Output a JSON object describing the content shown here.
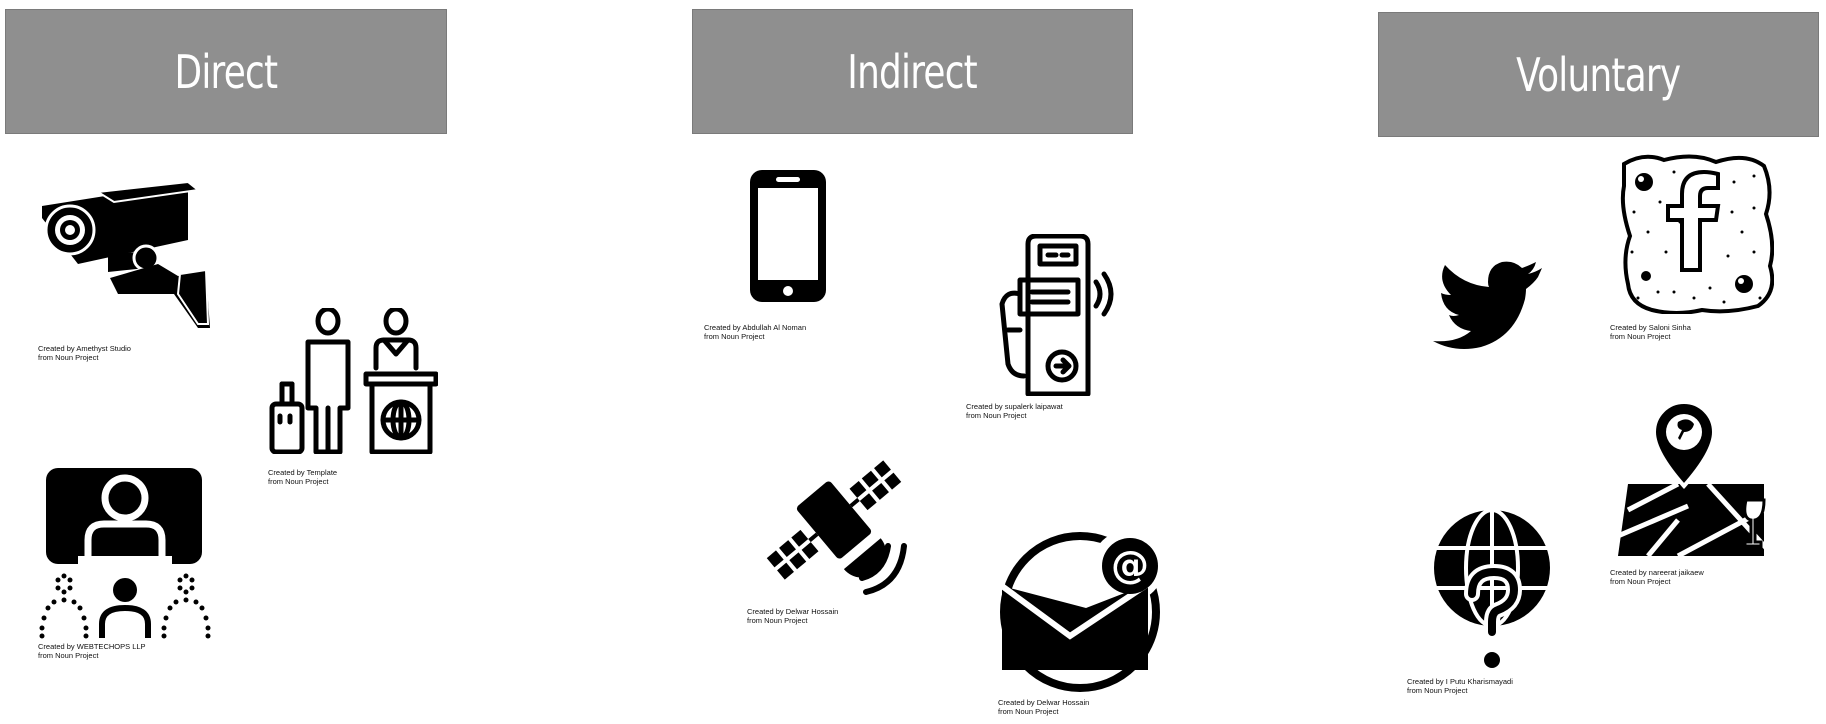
{
  "headers": {
    "direct": "Direct",
    "indirect": "Indirect",
    "voluntary": "Voluntary"
  },
  "colors": {
    "header_bg": "#8f8f8f",
    "header_text": "#ffffff",
    "icon": "#000000"
  },
  "direct": [
    {
      "icon": "cctv-camera-icon",
      "credit": "Created by Amethyst Studio",
      "source": "from Noun Project"
    },
    {
      "icon": "airport-checkin-icon",
      "credit": "Created by Template",
      "source": "from Noun Project"
    },
    {
      "icon": "presentation-audience-icon",
      "credit": "Created by WEBTECHOPS LLP",
      "source": "from Noun Project"
    }
  ],
  "indirect": [
    {
      "icon": "smartphone-icon",
      "credit": "Created by Abdullah Al Noman",
      "source": "from Noun Project"
    },
    {
      "icon": "contactless-payment-icon",
      "credit": "Created by supalerk laipawat",
      "source": "from Noun Project"
    },
    {
      "icon": "satellite-icon",
      "credit": "Created by Delwar Hossain",
      "source": "from Noun Project"
    },
    {
      "icon": "email-icon",
      "credit": "Created by Delwar Hossain",
      "source": "from Noun Project"
    }
  ],
  "voluntary": [
    {
      "icon": "twitter-bird-icon"
    },
    {
      "icon": "facebook-icon",
      "credit": "Created by Saloni Sinha",
      "source": "from Noun Project"
    },
    {
      "icon": "map-location-pin-icon",
      "credit": "Created by nareerat jaikaew",
      "source": "from Noun Project"
    },
    {
      "icon": "globe-question-icon",
      "credit": "Created by I Putu Kharismayadi",
      "source": "from Noun Project"
    }
  ]
}
